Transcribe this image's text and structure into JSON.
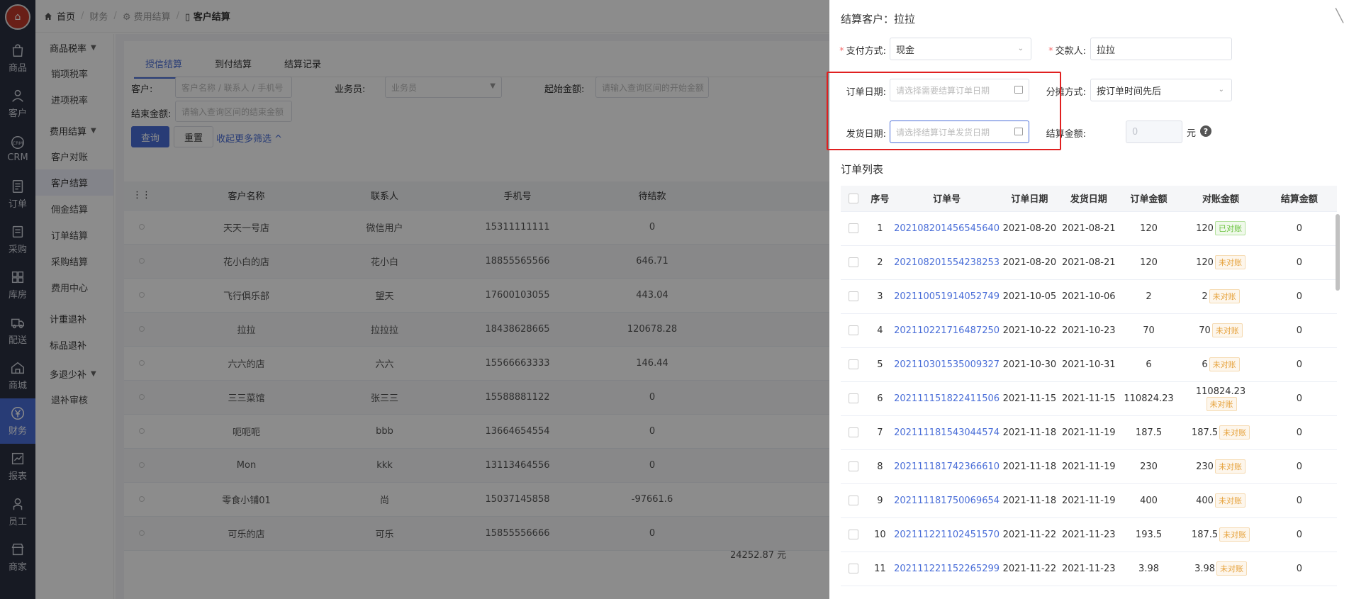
{
  "rail": {
    "items": [
      {
        "label": "商品",
        "icon": "bag-icon"
      },
      {
        "label": "客户",
        "icon": "user-icon"
      },
      {
        "label": "CRM",
        "icon": "crm-icon"
      },
      {
        "label": "订单",
        "icon": "doc-icon"
      },
      {
        "label": "采购",
        "icon": "cart-icon"
      },
      {
        "label": "库房",
        "icon": "grid-icon"
      },
      {
        "label": "配送",
        "icon": "truck-icon"
      },
      {
        "label": "商城",
        "icon": "home-icon"
      },
      {
        "label": "财务",
        "icon": "yen-icon"
      },
      {
        "label": "报表",
        "icon": "chart-icon"
      },
      {
        "label": "员工",
        "icon": "person-icon"
      },
      {
        "label": "商家",
        "icon": "shop-icon"
      }
    ],
    "active_index": 8
  },
  "breadcrumb": {
    "home": "首页",
    "l1": "财务",
    "l2": "费用结算",
    "current": "客户结算"
  },
  "submenu": {
    "g1": "商品税率",
    "g1_items": [
      "销项税率",
      "进项税率"
    ],
    "g2": "费用结算",
    "g2_items": [
      "客户对账",
      "客户结算",
      "佣金结算",
      "订单结算",
      "采购结算",
      "费用中心"
    ],
    "s1": "计重退补",
    "s2": "标品退补",
    "g3": "多退少补",
    "g3_items": [
      "退补审核"
    ]
  },
  "main": {
    "tabs": [
      "授信结算",
      "到付结算",
      "结算记录"
    ],
    "filters": {
      "customer_label": "客户:",
      "customer_ph": "客户名称 / 联系人 / 手机号",
      "salesman_label": "业务员:",
      "salesman_ph": "业务员",
      "start_label": "起始金额:",
      "start_ph": "请输入查询区间的开始金额",
      "end_label": "结束金额:",
      "end_ph": "请输入查询区间的结束金额"
    },
    "query_btn": "查询",
    "reset_btn": "重置",
    "more_link": "收起更多筛选 ^",
    "columns": [
      "客户名称",
      "联系人",
      "手机号",
      "待结款"
    ],
    "rows": [
      [
        "天天一号店",
        "微信用户",
        "15311111111",
        "0"
      ],
      [
        "花小白的店",
        "花小白",
        "18855565566",
        "646.71"
      ],
      [
        "飞行俱乐部",
        "望天",
        "17600103055",
        "443.04"
      ],
      [
        "拉拉",
        "拉拉拉",
        "18438628665",
        "120678.28"
      ],
      [
        "六六的店",
        "六六",
        "15566663333",
        "146.44"
      ],
      [
        "三三菜馆",
        "张三三",
        "15588881122",
        "0"
      ],
      [
        "呃呃呃",
        "bbb",
        "13664654554",
        "0"
      ],
      [
        "Mon",
        "kkk",
        "13113464556",
        "0"
      ],
      [
        "零食小铺01",
        "尚",
        "15037145858",
        "-97661.6"
      ],
      [
        "可乐的店",
        "可乐",
        "15855556666",
        "0"
      ]
    ],
    "total": "24252.87 元"
  },
  "drawer": {
    "title": "结算客户：拉拉",
    "pay_label": "支付方式:",
    "pay_value": "现金",
    "payer_label": "交款人:",
    "payer_value": "拉拉",
    "order_date_label": "订单日期:",
    "order_date_ph": "请选择需要结算订单日期",
    "alloc_label": "分摊方式:",
    "alloc_value": "按订单时间先后",
    "ship_date_label": "发货日期:",
    "ship_date_ph": "请选择结算订单发货日期",
    "amount_label": "结算金额:",
    "amount_value": "0",
    "amount_unit": "元",
    "section": "订单列表",
    "columns": [
      "序号",
      "订单号",
      "订单日期",
      "发货日期",
      "订单金额",
      "对账金额",
      "结算金额"
    ],
    "orders": [
      {
        "no": "1",
        "id": "202108201456545640",
        "date": "2021-08-20",
        "ship": "2021-08-21",
        "amt": "120",
        "rec": "120",
        "tag": "已对账",
        "settle": "0"
      },
      {
        "no": "2",
        "id": "202108201554238253",
        "date": "2021-08-20",
        "ship": "2021-08-21",
        "amt": "120",
        "rec": "120",
        "tag": "未对账",
        "settle": "0"
      },
      {
        "no": "3",
        "id": "202110051914052749",
        "date": "2021-10-05",
        "ship": "2021-10-06",
        "amt": "2",
        "rec": "2",
        "tag": "未对账",
        "settle": "0"
      },
      {
        "no": "4",
        "id": "202110221716487250",
        "date": "2021-10-22",
        "ship": "2021-10-23",
        "amt": "70",
        "rec": "70",
        "tag": "未对账",
        "settle": "0"
      },
      {
        "no": "5",
        "id": "202110301535009327",
        "date": "2021-10-30",
        "ship": "2021-10-31",
        "amt": "6",
        "rec": "6",
        "tag": "未对账",
        "settle": "0"
      },
      {
        "no": "6",
        "id": "202111151822411506",
        "date": "2021-11-15",
        "ship": "2021-11-15",
        "amt": "110824.23",
        "rec": "110824.23",
        "tag": "未对账",
        "settle": "0"
      },
      {
        "no": "7",
        "id": "202111181543044574",
        "date": "2021-11-18",
        "ship": "2021-11-19",
        "amt": "187.5",
        "rec": "187.5",
        "tag": "未对账",
        "settle": "0"
      },
      {
        "no": "8",
        "id": "202111181742366610",
        "date": "2021-11-18",
        "ship": "2021-11-19",
        "amt": "230",
        "rec": "230",
        "tag": "未对账",
        "settle": "0"
      },
      {
        "no": "9",
        "id": "202111181750069654",
        "date": "2021-11-18",
        "ship": "2021-11-19",
        "amt": "400",
        "rec": "400",
        "tag": "未对账",
        "settle": "0"
      },
      {
        "no": "10",
        "id": "202111221102451570",
        "date": "2021-11-22",
        "ship": "2021-11-23",
        "amt": "193.5",
        "rec": "187.5",
        "tag": "未对账",
        "settle": "0"
      },
      {
        "no": "11",
        "id": "202111221152265299",
        "date": "2021-11-22",
        "ship": "2021-11-23",
        "amt": "3.98",
        "rec": "3.98",
        "tag": "未对账",
        "settle": "0"
      }
    ]
  },
  "colors": {
    "accent": "#4a6ed8",
    "rail": "#2b3040",
    "highlight": "#e02020",
    "tag_ok": "#67c23a",
    "tag_pending": "#e6a23c"
  }
}
